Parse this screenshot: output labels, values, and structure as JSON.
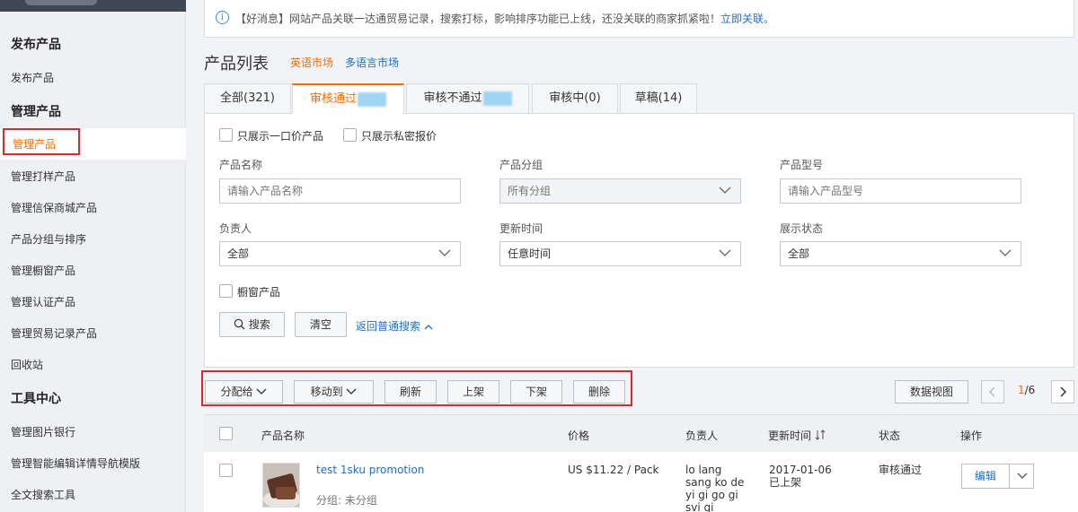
{
  "sidebar": {
    "sections": [
      {
        "title": "发布产品",
        "items": [
          "发布产品"
        ]
      },
      {
        "title": "管理产品",
        "items": [
          "管理产品",
          "管理打样产品",
          "管理信保商城产品",
          "产品分组与排序",
          "管理橱窗产品",
          "管理认证产品",
          "管理贸易记录产品",
          "回收站"
        ]
      },
      {
        "title": "工具中心",
        "items": [
          "管理图片银行",
          "管理智能编辑详情导航模版",
          "全文搜索工具"
        ]
      }
    ],
    "active_item": "管理产品"
  },
  "notice": {
    "text": "【好消息】网站产品关联一达通贸易记录，搜索打标，影响排序功能已上线，还没关联的商家抓紧啦！",
    "link": "立即关联。"
  },
  "page": {
    "title": "产品列表",
    "markets": [
      "英语市场",
      "多语言市场"
    ]
  },
  "tabs": [
    {
      "label": "全部(321)"
    },
    {
      "label": "审核通过"
    },
    {
      "label": "审核不通过"
    },
    {
      "label": "审核中(0)"
    },
    {
      "label": "草稿(14)"
    }
  ],
  "filters": {
    "checkbox_fixed_price": "只展示一口价产品",
    "checkbox_private_quote": "只展示私密报价",
    "product_name": {
      "label": "产品名称",
      "placeholder": "请输入产品名称"
    },
    "product_group": {
      "label": "产品分组",
      "value": "所有分组"
    },
    "product_model": {
      "label": "产品型号",
      "placeholder": "请输入产品型号"
    },
    "owner": {
      "label": "负责人",
      "value": "全部"
    },
    "update_time": {
      "label": "更新时间",
      "value": "任意时间"
    },
    "display_status": {
      "label": "展示状态",
      "value": "全部"
    },
    "showcase_checkbox": "橱窗产品",
    "search_button": "搜索",
    "clear_button": "清空",
    "back_link": "返回普通搜索"
  },
  "toolbar": {
    "assign": "分配给",
    "move_to": "移动到",
    "refresh": "刷新",
    "list_on": "上架",
    "list_off": "下架",
    "delete": "删除",
    "data_view": "数据视图",
    "page_current": "1",
    "page_total": "/6"
  },
  "table": {
    "headers": {
      "name": "产品名称",
      "price": "价格",
      "owner": "负责人",
      "updated": "更新时间",
      "status": "状态",
      "actions": "操作"
    },
    "rows": [
      {
        "name": "test 1sku promotion",
        "group": "分组: 未分组",
        "price": "US $11.22 / Pack",
        "owner": [
          "lo lang",
          "sang ko de",
          "yi gi go gi",
          "svi gi"
        ],
        "date": "2017-01-06",
        "listed": "已上架",
        "status": "审核通过",
        "edit": "编辑"
      }
    ]
  },
  "colors": {
    "accent": "#ff6a00",
    "link": "#1e6fc8",
    "highlight_box": "#e0262a"
  }
}
